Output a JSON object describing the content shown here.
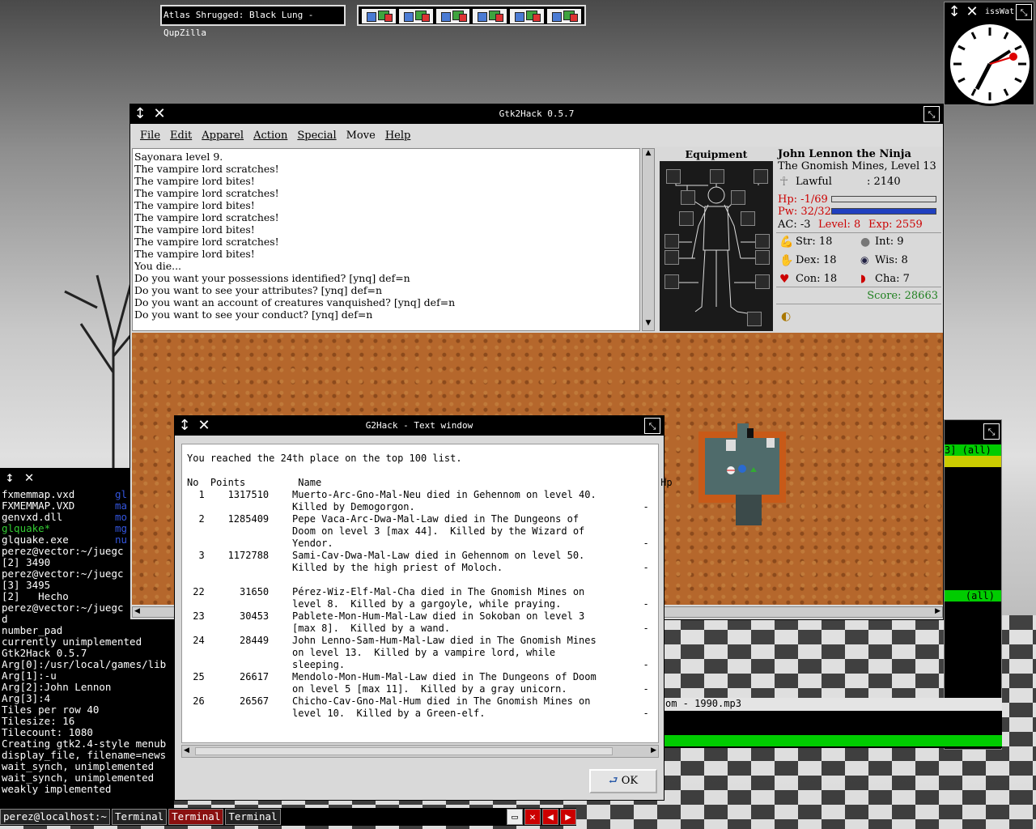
{
  "topbar": {
    "active_task": "Atlas Shrugged: Black Lung - QupZilla"
  },
  "clock": {
    "title": "issWat"
  },
  "main_window": {
    "title": "Gtk2Hack 0.5.7",
    "menu": [
      "File",
      "Edit",
      "Apparel",
      "Action",
      "Special",
      "Move",
      "Help"
    ],
    "messages": [
      "Sayonara level 9.",
      "The vampire lord scratches!",
      "The vampire lord bites!",
      "The vampire lord scratches!",
      "The vampire lord bites!",
      "The vampire lord scratches!",
      "The vampire lord bites!",
      "The vampire lord scratches!",
      "The vampire lord bites!",
      "You die...",
      "Do you want your possessions identified? [ynq] def=n",
      "Do you want to see your attributes? [ynq] def=n",
      "Do you want an account of creatures vanquished? [ynq] def=n",
      "Do you want to see your conduct? [ynq] def=n"
    ],
    "equipment_label": "Equipment",
    "stats": {
      "name": "John Lennon the Ninja",
      "location": "The Gnomish Mines, Level 13",
      "alignment": "Lawful",
      "gold": ": 2140",
      "hp": "Hp: -1/69",
      "pw": "Pw: 32/32",
      "hp_fraction": 0,
      "pw_fraction": 1,
      "ac": "AC: -3",
      "level": "Level: 8",
      "exp": "Exp: 2559",
      "str": "Str: 18",
      "int": "Int: 9",
      "dex": "Dex: 18",
      "wis": "Wis: 8",
      "con": "Con: 18",
      "cha": "Cha: 7",
      "score": "Score: 28663",
      "colors": {
        "hp": "#cc0000",
        "pw": "#2040c0",
        "score": "#208020"
      }
    }
  },
  "dialog": {
    "title": "G2Hack - Text window",
    "ok": "OK",
    "heading": "You reached the 24th place on the top 100 list.",
    "columns": {
      "no": "No",
      "points": "Points",
      "name": "Name",
      "hp": "Hp"
    },
    "entries": [
      {
        "no": "1",
        "points": "1317510",
        "lines": [
          "Muerto-Arc-Gno-Mal-Neu died in Gehennom on level 40.",
          "Killed by Demogorgon."
        ],
        "hp": "-"
      },
      {
        "no": "2",
        "points": "1285409",
        "lines": [
          "Pepe Vaca-Arc-Dwa-Mal-Law died in The Dungeons of",
          "Doom on level 3 [max 44].  Killed by the Wizard of",
          "Yendor."
        ],
        "hp": "-"
      },
      {
        "no": "3",
        "points": "1172788",
        "lines": [
          "Sami-Cav-Dwa-Mal-Law died in Gehennom on level 50.",
          "Killed by the high priest of Moloch."
        ],
        "hp": "-"
      },
      {
        "no": "22",
        "points": "31650",
        "lines": [
          "Pérez-Wiz-Elf-Mal-Cha died in The Gnomish Mines on",
          "level 8.  Killed by a gargoyle, while praying."
        ],
        "hp": "-"
      },
      {
        "no": "23",
        "points": "30453",
        "lines": [
          "Pablete-Mon-Hum-Mal-Law died in Sokoban on level 3",
          "[max 8].  Killed by a wand."
        ],
        "hp": "-"
      },
      {
        "no": "24",
        "points": "28449",
        "lines": [
          "John Lenno-Sam-Hum-Mal-Law died in The Gnomish Mines",
          "on level 13.  Killed by a vampire lord, while",
          "sleeping."
        ],
        "hp": "-"
      },
      {
        "no": "25",
        "points": "26617",
        "lines": [
          "Mendolo-Mon-Hum-Mal-Law died in The Dungeons of Doom",
          "on level 5 [max 11].  Killed by a gray unicorn."
        ],
        "hp": "-"
      },
      {
        "no": "26",
        "points": "26567",
        "lines": [
          "Chicho-Cav-Gno-Mal-Hum died in The Gnomish Mines on",
          "level 10.  Killed by a Green-elf."
        ],
        "hp": "-"
      }
    ]
  },
  "terminal": {
    "lines": [
      "fxmemmap.vxd",
      "FXMEMMAP.VXD",
      "genvxd.dll",
      "glquake*",
      "glquake.exe",
      "perez@vector:~/juegc",
      "[2] 3490",
      "perez@vector:~/juegc",
      "[3] 3495",
      "[2]   Hecho",
      "perez@vector:~/juegc",
      "d",
      "number_pad",
      "currently unimplemented",
      "Gtk2Hack 0.5.7",
      "Arg[0]:/usr/local/games/lib",
      "Arg[1]:-u",
      "Arg[2]:John Lennon",
      "Arg[3]:4",
      "Tiles per row 40",
      "Tilesize: 16",
      "Tilecount: 1080",
      "Creating gtk2.4-style menub",
      "display_file, filename=news",
      "wait_synch, unimplemented",
      "wait_synch, unimplemented",
      "weakly implemented"
    ],
    "right_col": [
      "gl",
      "ma",
      "mo",
      "mg",
      "nu"
    ]
  },
  "right_window": {
    "rows": [
      "3] (all)",
      "(all)"
    ],
    "mp3": "om - 1990.mp3"
  },
  "taskbar": {
    "items": [
      "perez@localhost:~",
      "Terminal",
      "Terminal",
      "Terminal"
    ]
  }
}
